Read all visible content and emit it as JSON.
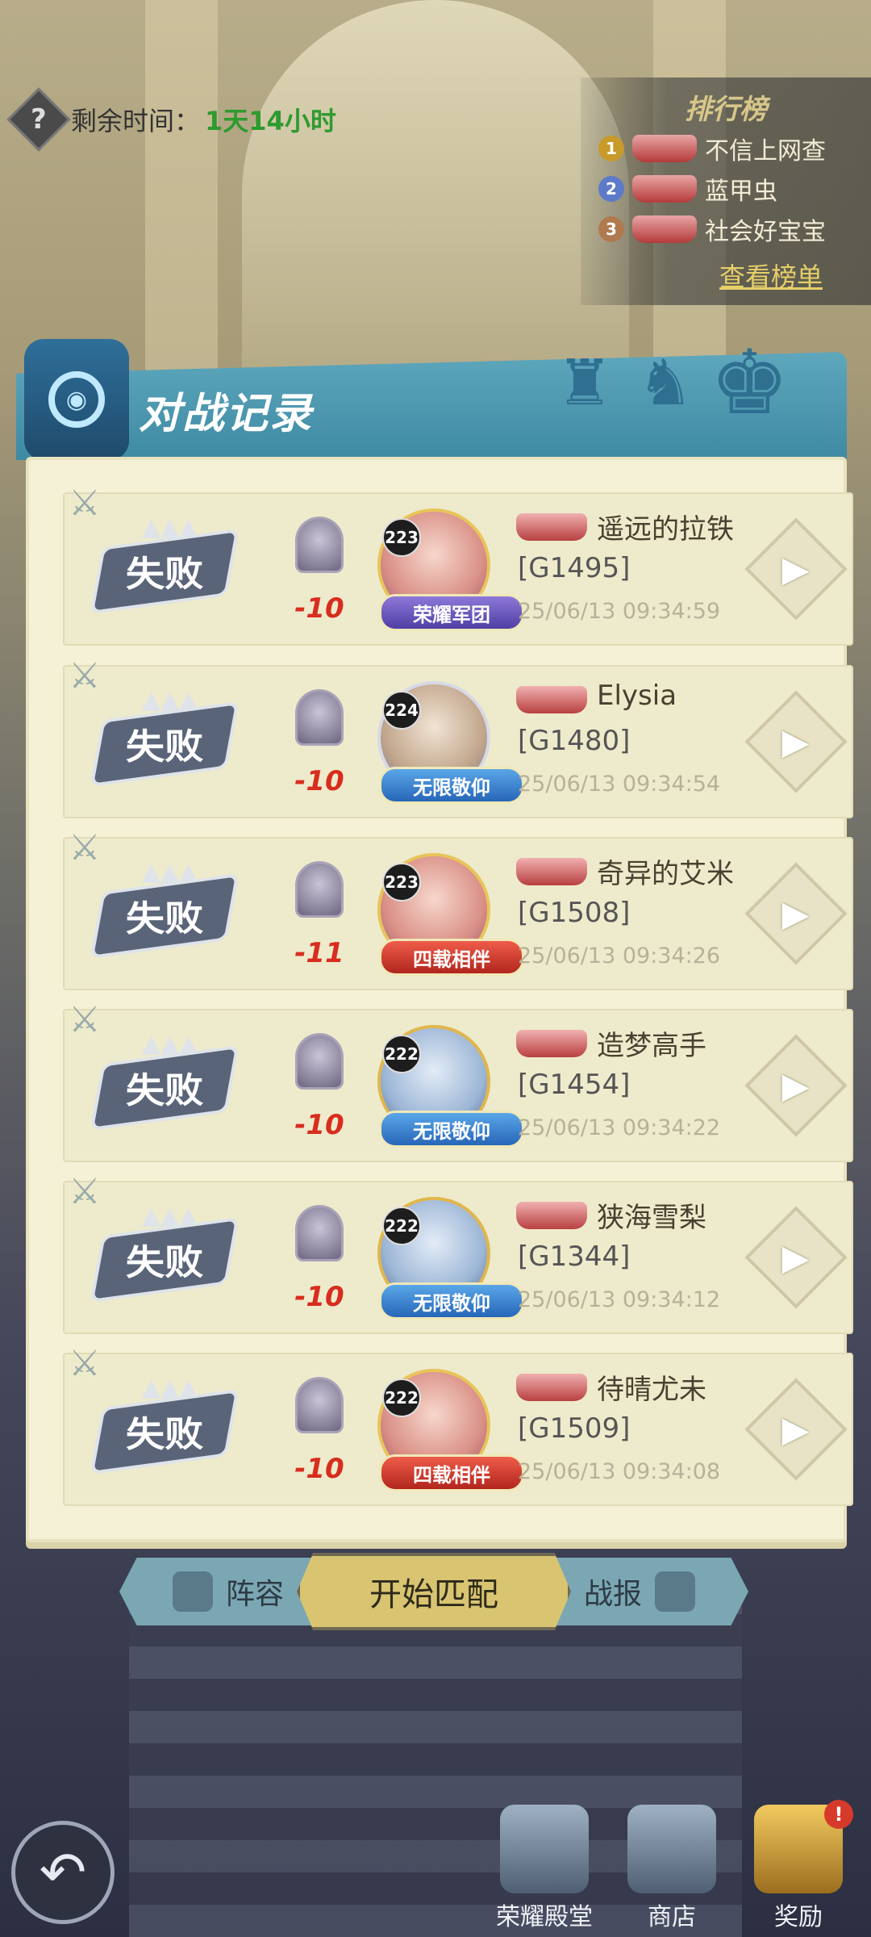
{
  "timer": {
    "icon": "question-icon",
    "label": "剩余时间：",
    "value": "1天14小时"
  },
  "ranking": {
    "title": "排行榜",
    "entries": [
      {
        "rank": "1",
        "name": "不信上网查",
        "color": "#c79a2a"
      },
      {
        "rank": "2",
        "name": "蓝甲虫",
        "color": "#5c7ac8"
      },
      {
        "rank": "3",
        "name": "社会好宝宝",
        "color": "#b07a4f"
      }
    ],
    "link": "查看榜单"
  },
  "banner": {
    "title": "对战记录"
  },
  "records": [
    {
      "result": "失败",
      "score": "-10",
      "level": "223",
      "skin_tag": "荣耀军团",
      "tag_style": "purple",
      "name": "遥远的拉铁",
      "code": "[G1495]",
      "time": "25/06/13 09:34:59",
      "avatar_style": ""
    },
    {
      "result": "失败",
      "score": "-10",
      "level": "224",
      "skin_tag": "无限敬仰",
      "tag_style": "blue",
      "name": "Elysia",
      "code": "[G1480]",
      "time": "25/06/13 09:34:54",
      "avatar_style": "silver"
    },
    {
      "result": "失败",
      "score": "-11",
      "level": "223",
      "skin_tag": "四载相伴",
      "tag_style": "red",
      "name": "奇异的艾米",
      "code": "[G1508]",
      "time": "25/06/13 09:34:26",
      "avatar_style": ""
    },
    {
      "result": "失败",
      "score": "-10",
      "level": "222",
      "skin_tag": "无限敬仰",
      "tag_style": "blue",
      "name": "造梦高手",
      "code": "[G1454]",
      "time": "25/06/13 09:34:22",
      "avatar_style": "blue"
    },
    {
      "result": "失败",
      "score": "-10",
      "level": "222",
      "skin_tag": "无限敬仰",
      "tag_style": "blue",
      "name": "狭海雪梨",
      "code": "[G1344]",
      "time": "25/06/13 09:34:12",
      "avatar_style": "blue"
    },
    {
      "result": "失败",
      "score": "-10",
      "level": "222",
      "skin_tag": "四载相伴",
      "tag_style": "red",
      "name": "待晴尤未",
      "code": "[G1509]",
      "time": "25/06/13 09:34:08",
      "avatar_style": ""
    }
  ],
  "tabs": {
    "left": "阵容",
    "middle": "开始匹配",
    "right": "战报"
  },
  "bottom_nav": {
    "hall": "荣耀殿堂",
    "shop": "商店",
    "reward": "奖励",
    "alert": "!"
  }
}
